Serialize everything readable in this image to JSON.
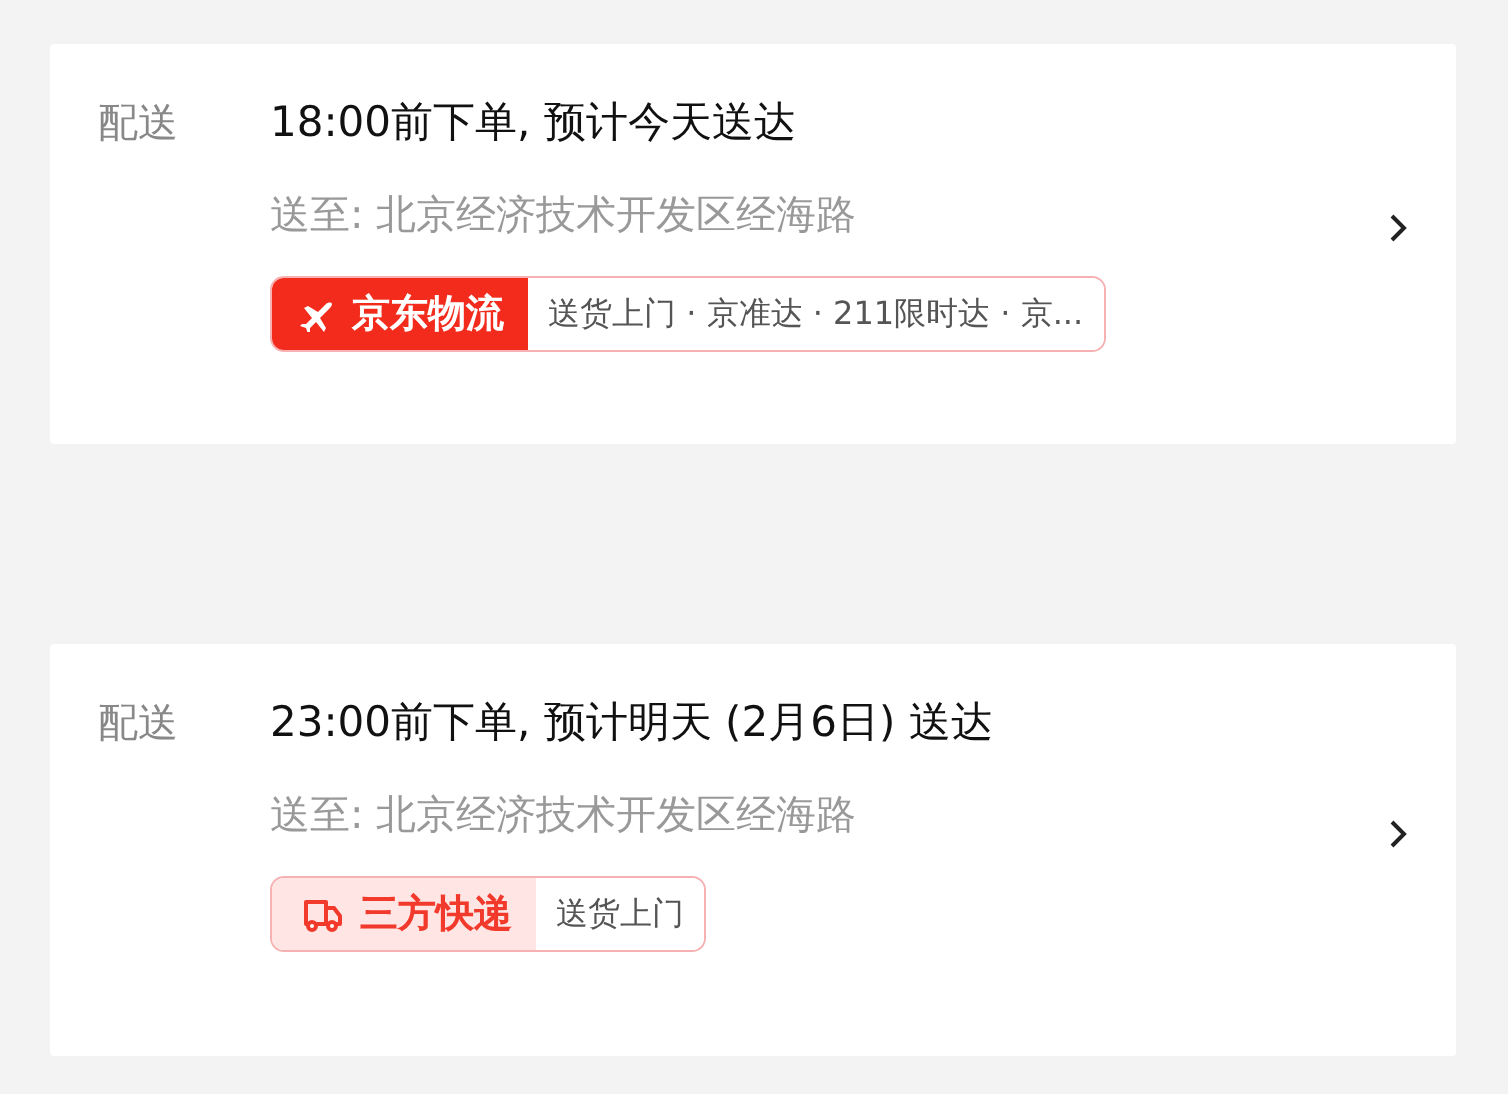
{
  "cards": [
    {
      "label": "配送",
      "headline": "18:00前下单, 预计今天送达",
      "address": "送至: 北京经济技术开发区经海路",
      "badge": {
        "kind": "solid",
        "brand": "京东物流",
        "services": "送货上门 · 京准达 · 211限时达 · 京..."
      }
    },
    {
      "label": "配送",
      "headline": "23:00前下单, 预计明天 (2月6日) 送达",
      "address": "送至: 北京经济技术开发区经海路",
      "badge": {
        "kind": "light",
        "brand": "三方快递",
        "services": "送货上门"
      }
    }
  ]
}
